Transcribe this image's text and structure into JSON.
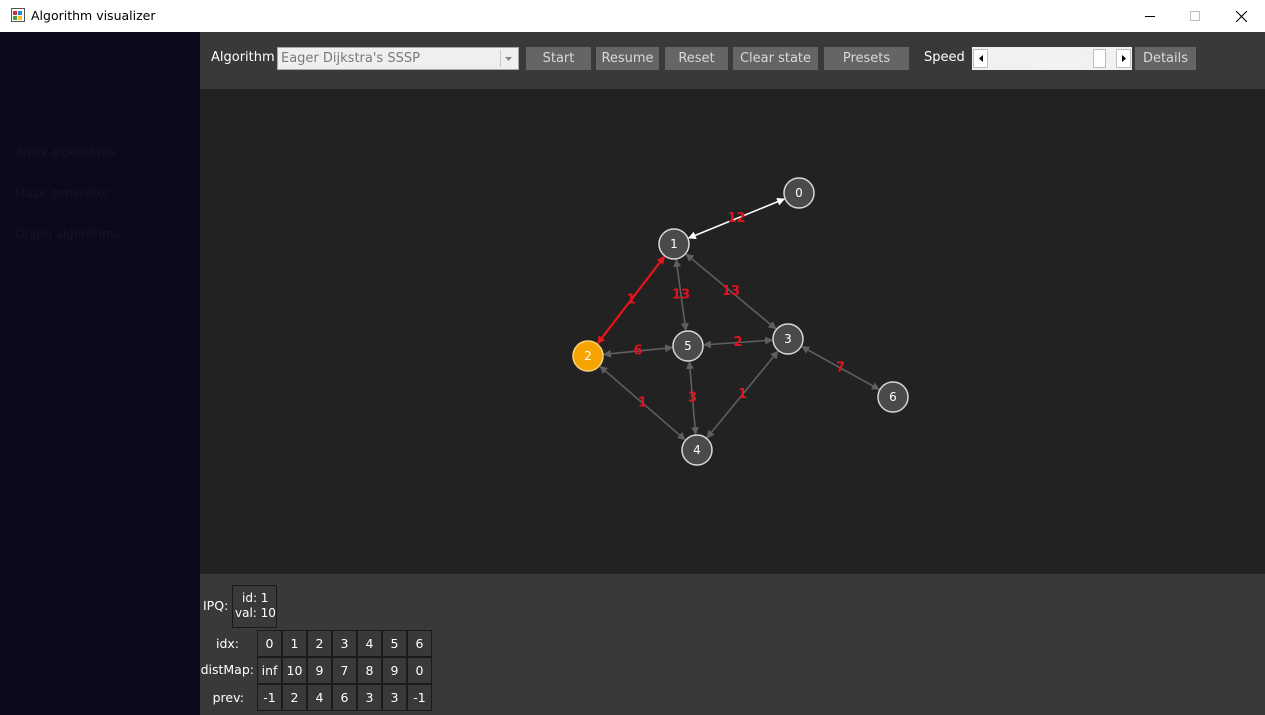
{
  "window": {
    "title": "Algorithm visualizer"
  },
  "sidebar": {
    "items": [
      {
        "label": "Array algorithms"
      },
      {
        "label": "Maze generator"
      },
      {
        "label": "Graph algorithms"
      }
    ]
  },
  "toolbar": {
    "algorithm_label": "Algorithm",
    "algorithm_value": "Eager Dijkstra's SSSP",
    "start": "Start",
    "resume": "Resume",
    "reset": "Reset",
    "clear_state": "Clear state",
    "presets": "Presets",
    "speed_label": "Speed",
    "speed_level": 0.92,
    "details": "Details"
  },
  "graph": {
    "nodes": [
      {
        "id": "0",
        "state": "default"
      },
      {
        "id": "1",
        "state": "default"
      },
      {
        "id": "2",
        "state": "current"
      },
      {
        "id": "3",
        "state": "default"
      },
      {
        "id": "4",
        "state": "default"
      },
      {
        "id": "5",
        "state": "default"
      },
      {
        "id": "6",
        "state": "default"
      }
    ],
    "edges": [
      {
        "a": "1",
        "b": "0",
        "weight": "12",
        "state": "white"
      },
      {
        "a": "1",
        "b": "2",
        "weight": "1",
        "state": "red"
      },
      {
        "a": "1",
        "b": "5",
        "weight": "13",
        "state": "default"
      },
      {
        "a": "1",
        "b": "3",
        "weight": "13",
        "state": "default"
      },
      {
        "a": "2",
        "b": "5",
        "weight": "6",
        "state": "default"
      },
      {
        "a": "5",
        "b": "3",
        "weight": "2",
        "state": "default"
      },
      {
        "a": "3",
        "b": "6",
        "weight": "7",
        "state": "default"
      },
      {
        "a": "2",
        "b": "4",
        "weight": "1",
        "state": "default"
      },
      {
        "a": "5",
        "b": "4",
        "weight": "3",
        "state": "default"
      },
      {
        "a": "4",
        "b": "3",
        "weight": "1",
        "state": "default"
      }
    ],
    "colors": {
      "node": "#4a4a4a",
      "current": "#f5a400",
      "edge": "#5f5f5f",
      "active": "#e8141c",
      "weight": "#e0141e"
    }
  },
  "ipq": {
    "label": "IPQ:",
    "id_line": "id: 1",
    "val_line": "val: 10"
  },
  "table": {
    "idx_label": "idx:",
    "dist_label": "distMap:",
    "prev_label": "prev:",
    "idx": [
      "0",
      "1",
      "2",
      "3",
      "4",
      "5",
      "6"
    ],
    "dist": [
      "inf",
      "10",
      "9",
      "7",
      "8",
      "9",
      "0"
    ],
    "prev": [
      "-1",
      "2",
      "4",
      "6",
      "3",
      "3",
      "-1"
    ]
  }
}
